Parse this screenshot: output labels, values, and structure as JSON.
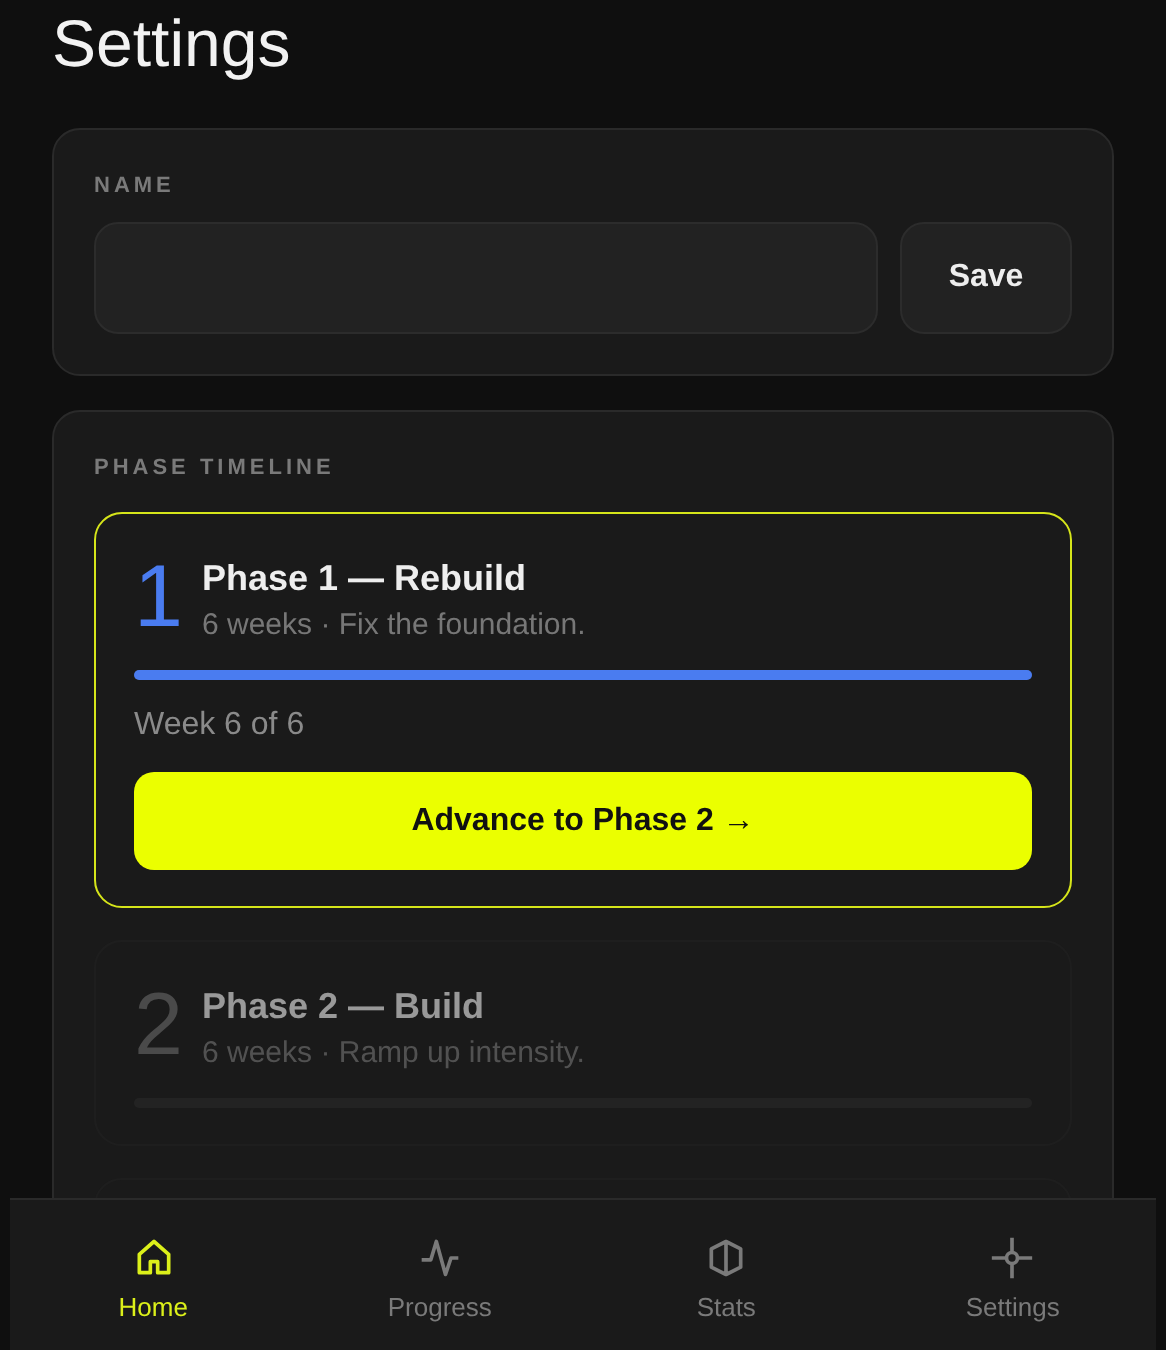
{
  "title": "Settings",
  "name_section": {
    "label": "NAME",
    "button": "Save"
  },
  "timeline": {
    "label": "PHASE TIMELINE",
    "phases": [
      {
        "number": "1",
        "title": "Phase 1 — Rebuild",
        "subtitle": "6 weeks · Fix the foundation.",
        "active": true,
        "level": 1,
        "week": "Week 6 of 6",
        "action": "Advance to Phase 2 →"
      },
      {
        "number": "2",
        "title": "Phase 2 — Build",
        "subtitle": "6 weeks · Ramp up intensity.",
        "active": false
      }
    ]
  },
  "nav": [
    {
      "label": "Home",
      "kind": "home",
      "selected": true
    },
    {
      "label": "Progress",
      "kind": "progress",
      "selected": false
    },
    {
      "label": "Stats",
      "kind": "stats",
      "selected": false
    },
    {
      "label": "Settings",
      "kind": "settings",
      "selected": false
    }
  ]
}
